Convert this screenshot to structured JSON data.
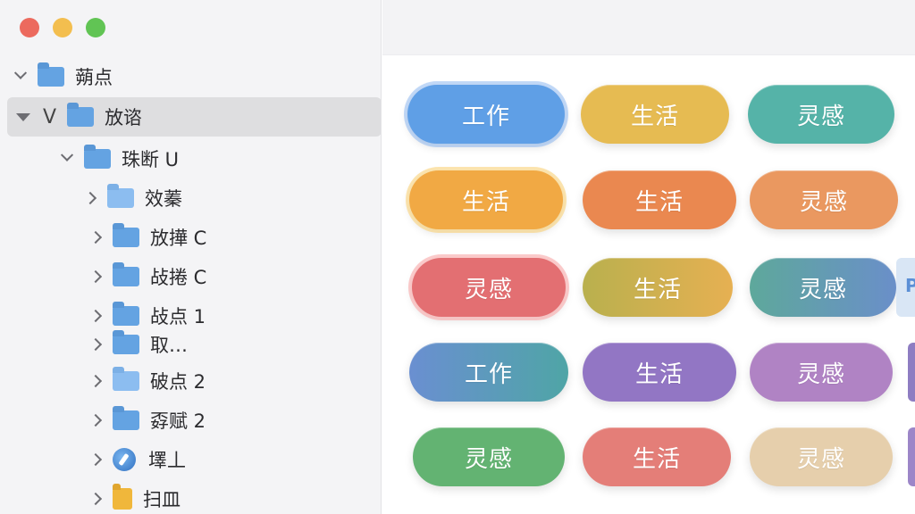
{
  "window": {
    "controls": [
      "close",
      "minimize",
      "zoom"
    ]
  },
  "sidebar": {
    "items": [
      {
        "label": "蒴点",
        "level": 0,
        "expanded": true,
        "icon": "folder-icon"
      },
      {
        "label": "放谘",
        "level": 0,
        "expanded": true,
        "selected": true,
        "marker": "V",
        "icon": "folder-icon"
      },
      {
        "label": "珠断 U",
        "level": 1,
        "expanded": true,
        "icon": "folder-icon"
      },
      {
        "label": "效蓁",
        "level": 2,
        "expanded": false,
        "icon": "folder-icon"
      },
      {
        "label": "放撶 C",
        "level": 2,
        "expanded": false,
        "icon": "folder-icon"
      },
      {
        "label": "敁捲 C",
        "level": 2,
        "expanded": false,
        "icon": "folder-icon"
      },
      {
        "label": "敁点 1",
        "level": 2,
        "expanded": false,
        "icon": "folder-icon"
      },
      {
        "label": "取…",
        "level": 2,
        "expanded": false,
        "icon": "folder-icon"
      },
      {
        "label": "破点 2",
        "level": 2,
        "expanded": false,
        "icon": "folder-icon"
      },
      {
        "label": "孬赋 2",
        "level": 2,
        "expanded": false,
        "icon": "folder-icon"
      },
      {
        "label": "墿丄",
        "level": 2,
        "expanded": false,
        "icon": "compass-icon"
      },
      {
        "label": "扫皿",
        "level": 2,
        "expanded": false,
        "icon": "folder-icon"
      }
    ]
  },
  "tags": {
    "rows": [
      [
        {
          "label": "工作",
          "color": "#5f9fe6"
        },
        {
          "label": "生活",
          "color": "#e6bb52"
        },
        {
          "label": "灵感",
          "color": "#55b3a8"
        }
      ],
      [
        {
          "label": "生活",
          "color": "#f1a944"
        },
        {
          "label": "生活",
          "color": "#ea8850"
        },
        {
          "label": "灵感",
          "color": "#ea9860"
        }
      ],
      [
        {
          "label": "灵感",
          "color": "#e36f72"
        },
        {
          "label": "生活",
          "color": "#d9b24e"
        },
        {
          "label": "灵感",
          "color": "#5ea89b"
        }
      ],
      [
        {
          "label": "工作",
          "color": "#6a8fd1"
        },
        {
          "label": "生活",
          "color": "#9276c4"
        },
        {
          "label": "灵感",
          "color": "#b083c4"
        }
      ],
      [
        {
          "label": "灵感",
          "color": "#63b372"
        },
        {
          "label": "生活",
          "color": "#e47e78"
        },
        {
          "label": "灵感",
          "color": "#e6cfac"
        }
      ]
    ],
    "edge_letter": "P"
  }
}
